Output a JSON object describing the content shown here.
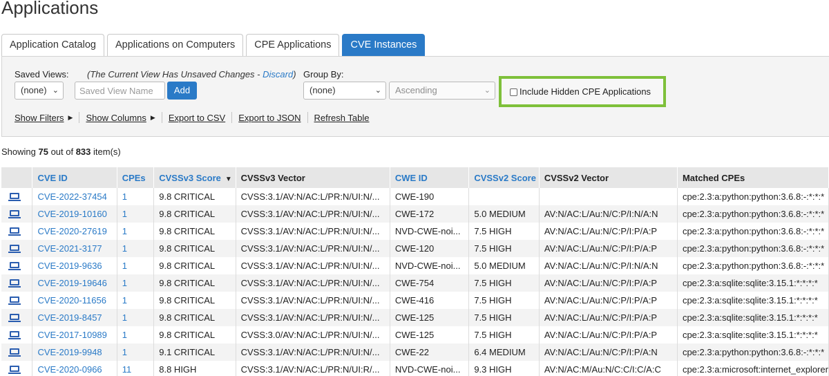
{
  "page": {
    "title": "Applications"
  },
  "tabs": [
    {
      "label": "Application Catalog",
      "active": false
    },
    {
      "label": "Applications on Computers",
      "active": false
    },
    {
      "label": "CPE Applications",
      "active": false
    },
    {
      "label": "CVE Instances",
      "active": true
    }
  ],
  "controls": {
    "saved_views_label": "Saved Views:",
    "saved_views_value": "(none)",
    "unsaved_note_prefix": "(The Current View Has Unsaved Changes - ",
    "unsaved_note_link": "Discard",
    "unsaved_note_suffix": ")",
    "saved_view_name_placeholder": "Saved View Name",
    "add_label": "Add",
    "group_by_label": "Group By:",
    "group_by_value": "(none)",
    "order_value": "Ascending",
    "include_hidden_label": "Include Hidden CPE Applications",
    "include_hidden_checked": false
  },
  "actions": {
    "show_filters": "Show Filters",
    "show_columns": "Show Columns",
    "export_csv": "Export to CSV",
    "export_json": "Export to JSON",
    "refresh": "Refresh Table"
  },
  "summary": {
    "prefix": "Showing ",
    "shown": "75",
    "middle": " out of ",
    "total": "833",
    "suffix": " item(s)"
  },
  "table": {
    "columns": [
      "",
      "CVE ID",
      "CPEs",
      "CVSSv3 Score",
      "CVSSv3 Vector",
      "CWE ID",
      "CVSSv2 Score",
      "CVSSv2 Vector",
      "Matched CPEs"
    ],
    "sorted_column": "CVSSv3 Score",
    "rows": [
      {
        "icon": "computer-icon",
        "cve": "CVE-2022-37454",
        "cpes": "1",
        "v3score": "9.8 CRITICAL",
        "v3vector": "CVSS:3.1/AV:N/AC:L/PR:N/UI:N/...",
        "cwe": "CWE-190",
        "v2score": "",
        "v2vector": "",
        "matched": "cpe:2.3:a:python:python:3.6.8:-:*:*:*"
      },
      {
        "icon": "computer-icon",
        "cve": "CVE-2019-10160",
        "cpes": "1",
        "v3score": "9.8 CRITICAL",
        "v3vector": "CVSS:3.1/AV:N/AC:L/PR:N/UI:N/...",
        "cwe": "CWE-172",
        "v2score": "5.0 MEDIUM",
        "v2vector": "AV:N/AC:L/Au:N/C:P/I:N/A:N",
        "matched": "cpe:2.3:a:python:python:3.6.8:-:*:*:*"
      },
      {
        "icon": "computer-icon",
        "cve": "CVE-2020-27619",
        "cpes": "1",
        "v3score": "9.8 CRITICAL",
        "v3vector": "CVSS:3.1/AV:N/AC:L/PR:N/UI:N/...",
        "cwe": "NVD-CWE-noi...",
        "v2score": "7.5 HIGH",
        "v2vector": "AV:N/AC:L/Au:N/C:P/I:P/A:P",
        "matched": "cpe:2.3:a:python:python:3.6.8:-:*:*:*"
      },
      {
        "icon": "computer-icon",
        "cve": "CVE-2021-3177",
        "cpes": "1",
        "v3score": "9.8 CRITICAL",
        "v3vector": "CVSS:3.1/AV:N/AC:L/PR:N/UI:N/...",
        "cwe": "CWE-120",
        "v2score": "7.5 HIGH",
        "v2vector": "AV:N/AC:L/Au:N/C:P/I:P/A:P",
        "matched": "cpe:2.3:a:python:python:3.6.8:-:*:*:*"
      },
      {
        "icon": "computer-icon",
        "cve": "CVE-2019-9636",
        "cpes": "1",
        "v3score": "9.8 CRITICAL",
        "v3vector": "CVSS:3.1/AV:N/AC:L/PR:N/UI:N/...",
        "cwe": "NVD-CWE-noi...",
        "v2score": "5.0 MEDIUM",
        "v2vector": "AV:N/AC:L/Au:N/C:P/I:N/A:N",
        "matched": "cpe:2.3:a:python:python:3.6.8:-:*:*:*"
      },
      {
        "icon": "computer-icon",
        "cve": "CVE-2019-19646",
        "cpes": "1",
        "v3score": "9.8 CRITICAL",
        "v3vector": "CVSS:3.1/AV:N/AC:L/PR:N/UI:N/...",
        "cwe": "CWE-754",
        "v2score": "7.5 HIGH",
        "v2vector": "AV:N/AC:L/Au:N/C:P/I:P/A:P",
        "matched": "cpe:2.3:a:sqlite:sqlite:3.15.1:*:*:*:*"
      },
      {
        "icon": "computer-icon",
        "cve": "CVE-2020-11656",
        "cpes": "1",
        "v3score": "9.8 CRITICAL",
        "v3vector": "CVSS:3.1/AV:N/AC:L/PR:N/UI:N/...",
        "cwe": "CWE-416",
        "v2score": "7.5 HIGH",
        "v2vector": "AV:N/AC:L/Au:N/C:P/I:P/A:P",
        "matched": "cpe:2.3:a:sqlite:sqlite:3.15.1:*:*:*:*"
      },
      {
        "icon": "computer-icon",
        "cve": "CVE-2019-8457",
        "cpes": "1",
        "v3score": "9.8 CRITICAL",
        "v3vector": "CVSS:3.1/AV:N/AC:L/PR:N/UI:N/...",
        "cwe": "CWE-125",
        "v2score": "7.5 HIGH",
        "v2vector": "AV:N/AC:L/Au:N/C:P/I:P/A:P",
        "matched": "cpe:2.3:a:sqlite:sqlite:3.15.1:*:*:*:*"
      },
      {
        "icon": "computer-icon",
        "cve": "CVE-2017-10989",
        "cpes": "1",
        "v3score": "9.8 CRITICAL",
        "v3vector": "CVSS:3.0/AV:N/AC:L/PR:N/UI:N/...",
        "cwe": "CWE-125",
        "v2score": "7.5 HIGH",
        "v2vector": "AV:N/AC:L/Au:N/C:P/I:P/A:P",
        "matched": "cpe:2.3:a:sqlite:sqlite:3.15.1:*:*:*:*"
      },
      {
        "icon": "computer-icon",
        "cve": "CVE-2019-9948",
        "cpes": "1",
        "v3score": "9.1 CRITICAL",
        "v3vector": "CVSS:3.1/AV:N/AC:L/PR:N/UI:N/...",
        "cwe": "CWE-22",
        "v2score": "6.4 MEDIUM",
        "v2vector": "AV:N/AC:L/Au:N/C:P/I:P/A:N",
        "matched": "cpe:2.3:a:python:python:3.6.8:-:*:*:*"
      },
      {
        "icon": "computer-icon",
        "cve": "CVE-2020-0966",
        "cpes": "11",
        "v3score": "8.8 HIGH",
        "v3vector": "CVSS:3.1/AV:N/AC:L/PR:N/UI:R/...",
        "cwe": "NVD-CWE-noi...",
        "v2score": "9.3 HIGH",
        "v2vector": "AV:N/AC:M/Au:N/C:C/I:C/A:C",
        "matched": "cpe:2.3:a:microsoft:internet_explorer"
      }
    ]
  },
  "colors": {
    "accent": "#2a7ac7",
    "highlight": "#7ec03a",
    "header_bg": "#e6e6e6",
    "panel_bg": "#f4f4f4"
  }
}
